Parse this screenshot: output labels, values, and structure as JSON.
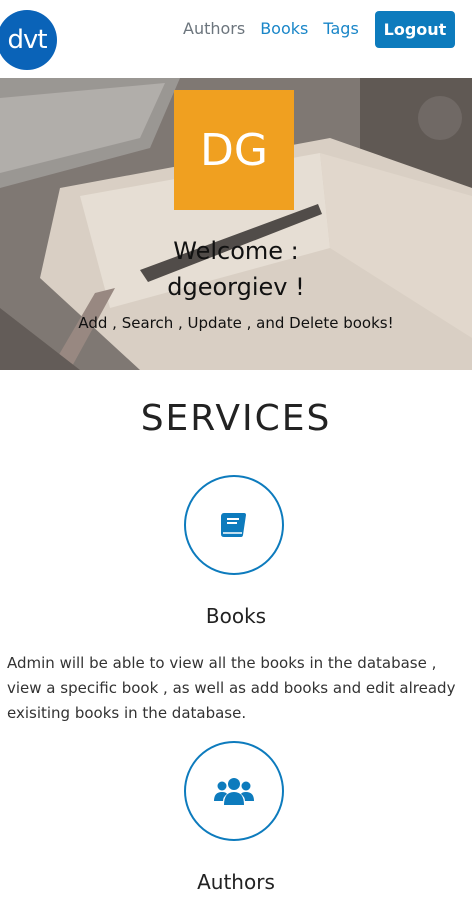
{
  "nav": {
    "logo_text": "dvt",
    "links": [
      "Authors",
      "Books",
      "Tags"
    ],
    "logout_label": "Logout"
  },
  "hero": {
    "avatar_initials": "DG",
    "welcome_line1": "Welcome :",
    "welcome_line2": "dgeorgiev !",
    "subtitle": "Add , Search , Update , and Delete books!"
  },
  "services": {
    "title": "SERVICES",
    "items": [
      {
        "icon": "book-icon",
        "heading": "Books",
        "description": "Admin will be able to view all the books in the database , view a specific book , as well as add books and edit already exisiting books in the database."
      },
      {
        "icon": "users-icon",
        "heading": "Authors",
        "description": ""
      }
    ]
  },
  "colors": {
    "primary": "#0d7bbd",
    "avatar": "#f0a020",
    "logo": "#0a63b8"
  }
}
